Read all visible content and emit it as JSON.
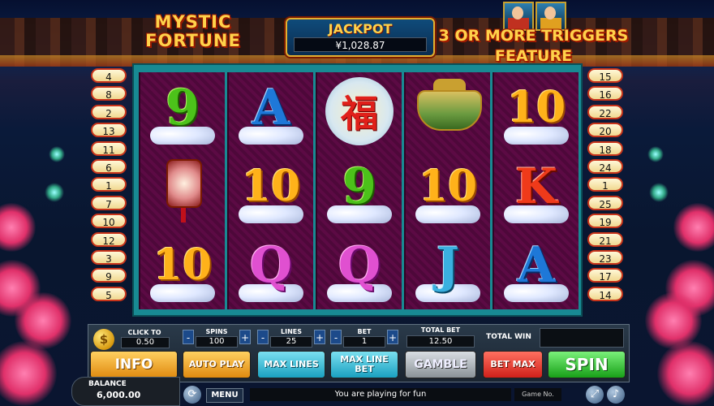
{
  "title": "MYSTIC FORTUNE",
  "jackpot": {
    "label": "JACKPOT",
    "value": "¥1,028.87"
  },
  "feature_text": "3 OR MORE TRIGGERS FEATURE",
  "paylines_left": [
    "4",
    "8",
    "2",
    "13",
    "11",
    "6",
    "1",
    "7",
    "10",
    "12",
    "3",
    "9",
    "5"
  ],
  "paylines_right": [
    "15",
    "16",
    "22",
    "20",
    "18",
    "24",
    "1",
    "25",
    "19",
    "21",
    "23",
    "17",
    "14"
  ],
  "reels": [
    [
      "9",
      "lantern",
      "10"
    ],
    [
      "A",
      "10",
      "Q"
    ],
    [
      "fu",
      "9",
      "Q"
    ],
    [
      "censer",
      "10",
      "J"
    ],
    [
      "10",
      "K",
      "A"
    ]
  ],
  "fu_char": "福",
  "controls": {
    "coin_symbol": "$",
    "click_to_change": "CLICK TO CHANGE",
    "coin_value": "0.50",
    "spins_label": "SPINS",
    "spins_value": "100",
    "lines_label": "LINES",
    "lines_value": "25",
    "bet_label": "BET",
    "bet_value": "1",
    "total_bet_label": "TOTAL BET",
    "total_bet_value": "12.50",
    "total_win_label": "TOTAL WIN",
    "total_win_value": "",
    "minus": "-",
    "plus": "+",
    "info": "INFO",
    "auto_play": "AUTO PLAY",
    "max_lines": "MAX LINES",
    "max_line_bet": "MAX LINE BET",
    "gamble": "GAMBLE",
    "bet_max": "BET MAX",
    "spin": "SPIN"
  },
  "footer": {
    "balance_label": "BALANCE",
    "balance_value": "6,000.00",
    "menu": "MENU",
    "message": "You are playing for fun",
    "game_no_label": "Game No."
  }
}
